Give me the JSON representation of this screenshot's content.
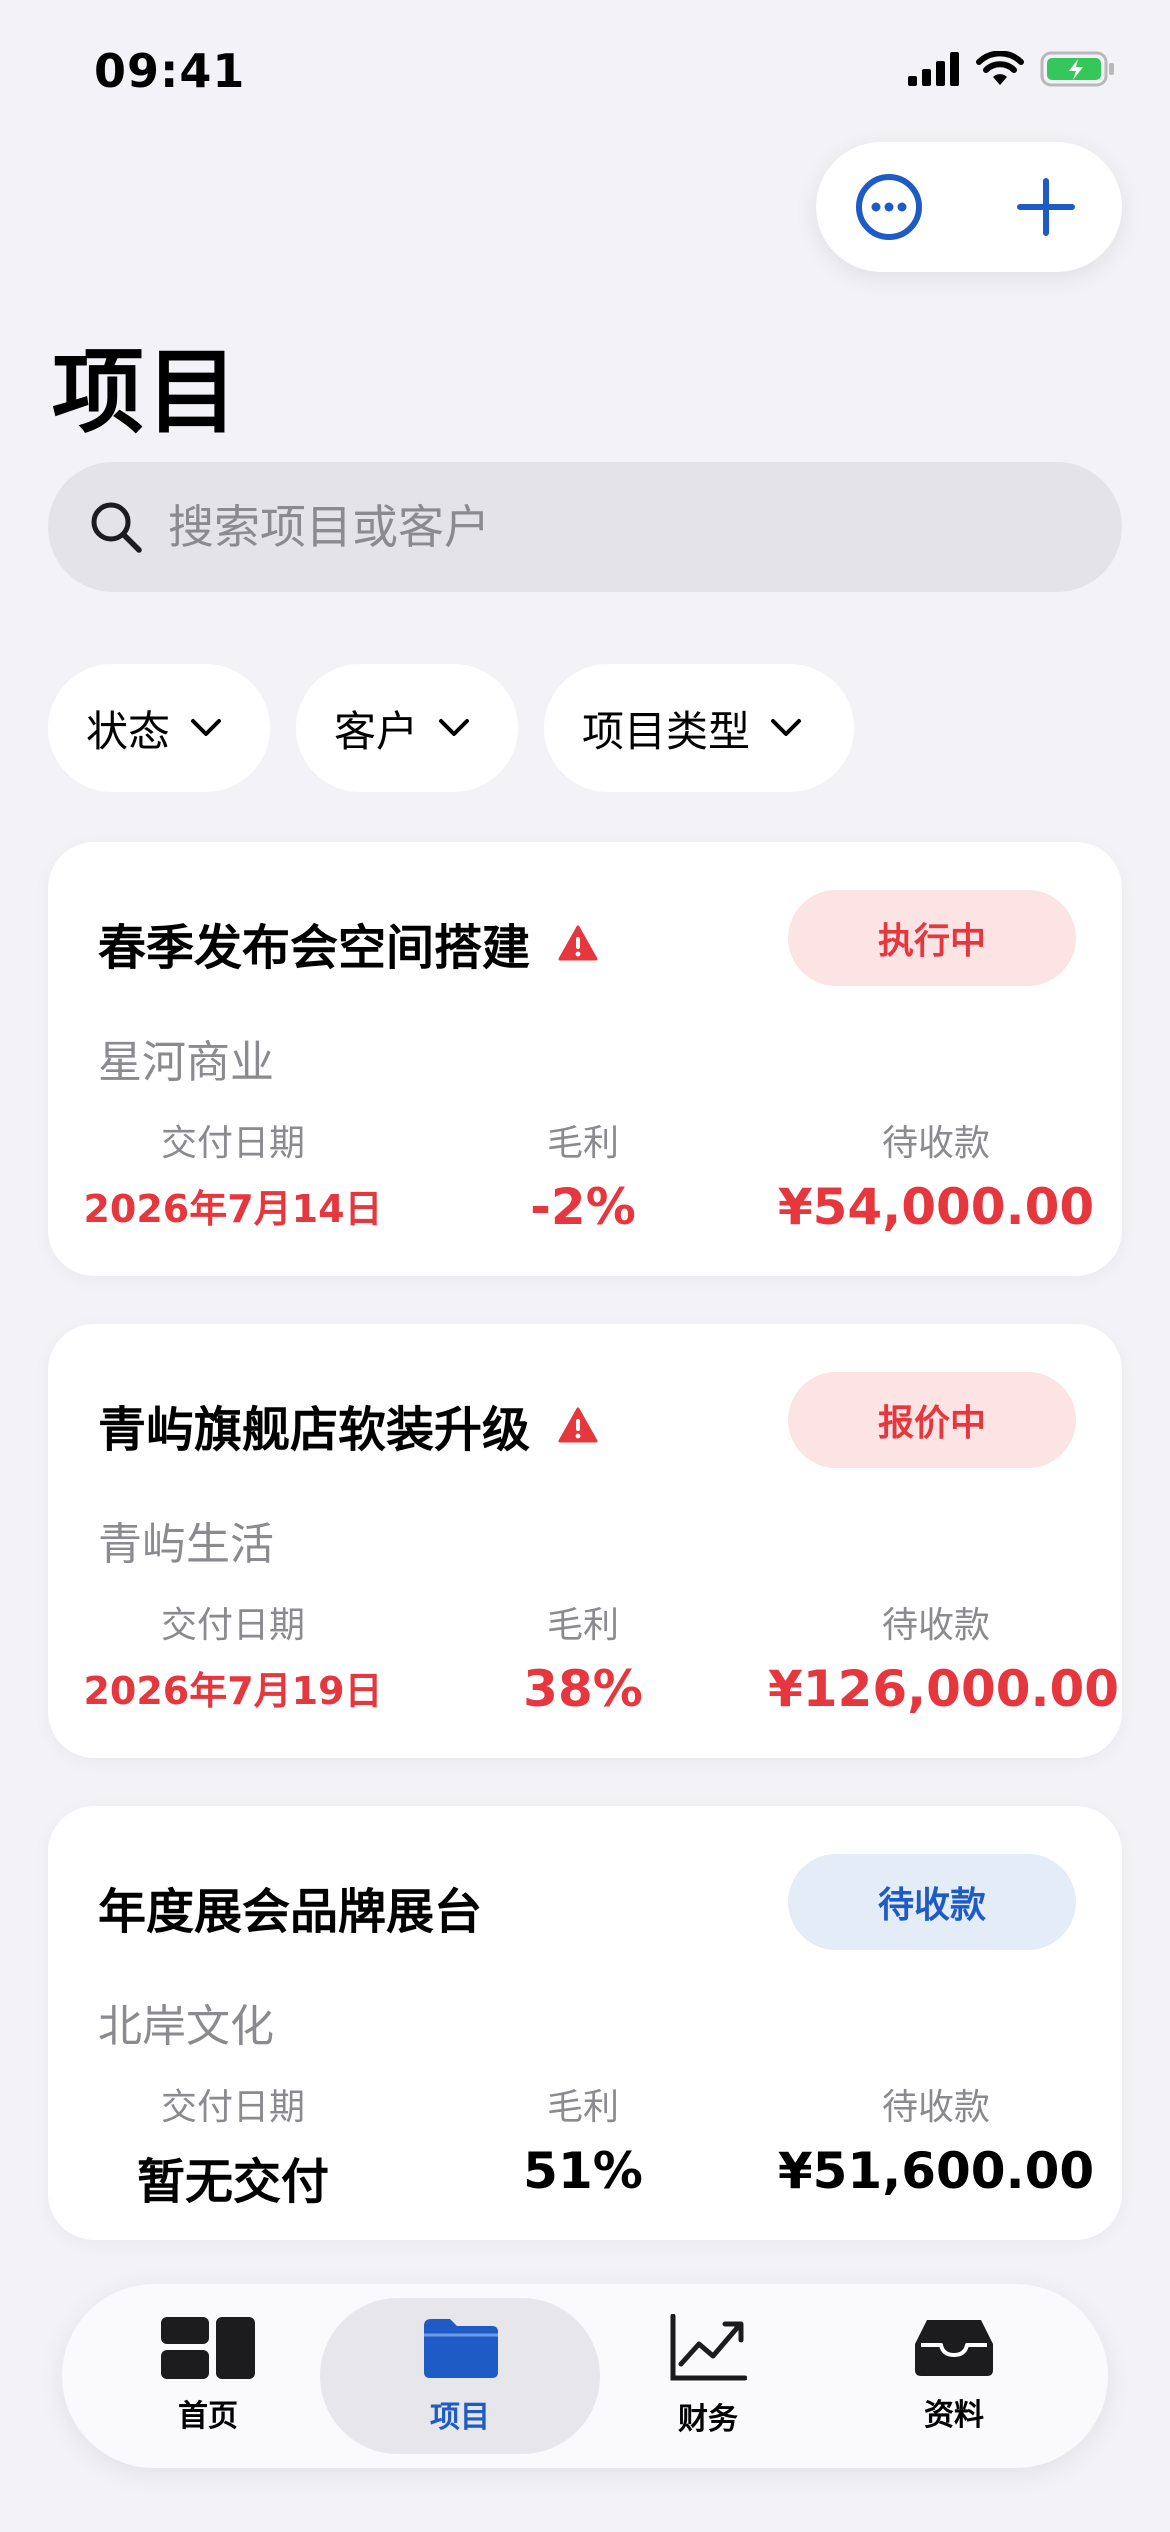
{
  "status_bar": {
    "time": "09:41"
  },
  "page": {
    "title": "项目"
  },
  "search": {
    "placeholder": "搜索项目或客户"
  },
  "filters": [
    {
      "label": "状态"
    },
    {
      "label": "客户"
    },
    {
      "label": "项目类型"
    }
  ],
  "metric_labels": {
    "date": "交付日期",
    "margin": "毛利",
    "due": "待收款"
  },
  "projects": [
    {
      "title": "春季发布会空间搭建",
      "warning": true,
      "status": "执行中",
      "status_color": "#e5373d",
      "client": "星河商业",
      "delivery_date": "2026年7月14日",
      "margin": "-2%",
      "receivable": "¥54,000.00"
    },
    {
      "title": "青屿旗舰店软装升级",
      "warning": true,
      "status": "报价中",
      "status_color": "#e5373d",
      "client": "青屿生活",
      "delivery_date": "2026年7月19日",
      "margin": "38%",
      "receivable": "¥126,000.00"
    },
    {
      "title": "年度展会品牌展台",
      "warning": false,
      "status": "待收款",
      "status_color": "#1f5bc4",
      "client": "北岸文化",
      "delivery_date": "暂无交付",
      "margin": "51%",
      "receivable": "¥51,600.00"
    }
  ],
  "tabbar": {
    "items": [
      {
        "label": "首页",
        "icon": "dashboard-icon"
      },
      {
        "label": "项目",
        "icon": "folder-icon",
        "active": true
      },
      {
        "label": "财务",
        "icon": "chart-line-icon"
      },
      {
        "label": "资料",
        "icon": "tray-icon"
      }
    ]
  },
  "colors": {
    "accent": "#1f5bc4",
    "danger": "#e5373d",
    "background": "#f2f2f7"
  }
}
